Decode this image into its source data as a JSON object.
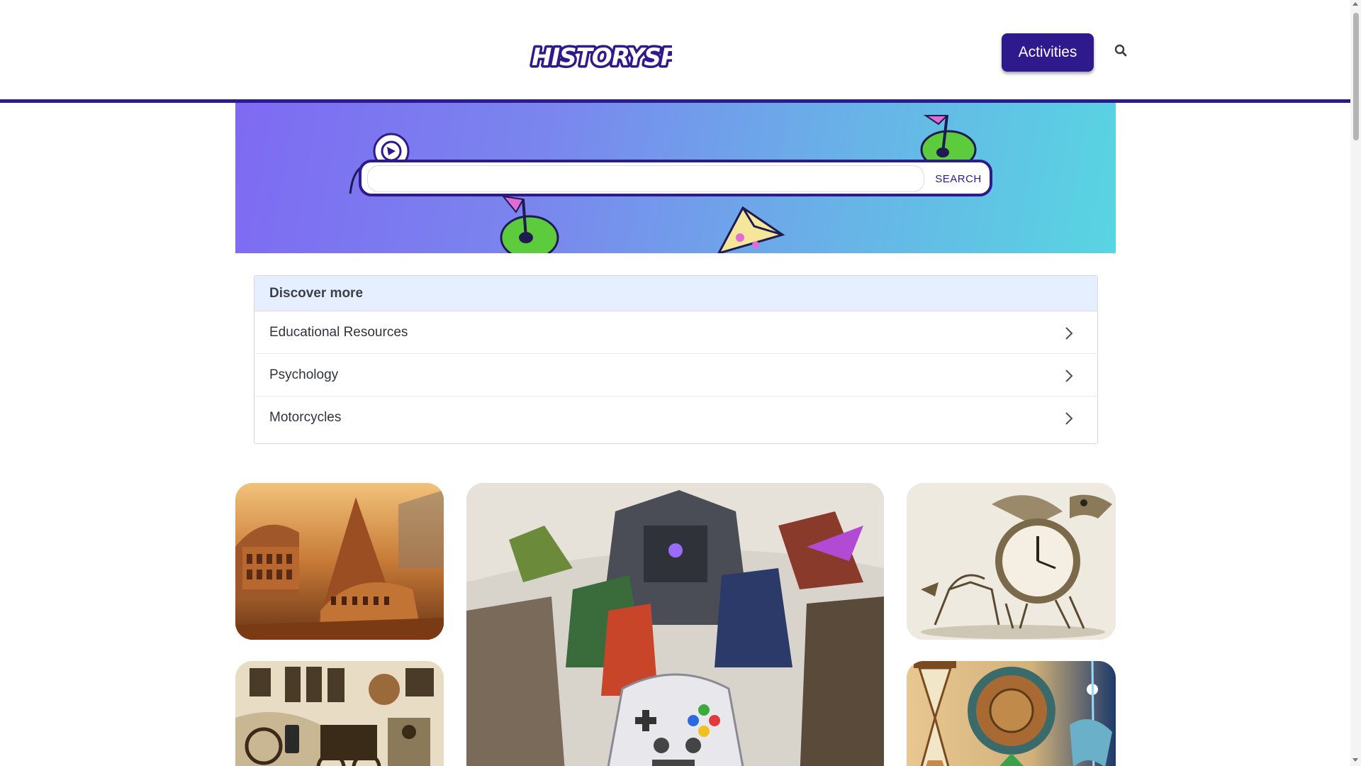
{
  "header": {
    "logo_text": "HISTORYSPOT",
    "activities_label": "Activities",
    "search_icon": "search-icon",
    "accent_color": "#2e1a8c"
  },
  "hero": {
    "search_placeholder": "",
    "search_button_label": "SEARCH",
    "gradient": [
      "#7e6af2",
      "#58d5e2"
    ]
  },
  "discover": {
    "title": "Discover more",
    "items": [
      {
        "label": "Educational Resources",
        "icon": "chevron-right-icon"
      },
      {
        "label": "Psychology",
        "icon": "chevron-right-icon"
      },
      {
        "label": "Motorcycles",
        "icon": "chevron-right-icon"
      }
    ]
  },
  "gallery": {
    "images": [
      {
        "subject": "ancient-architecture-collage"
      },
      {
        "subject": "video-game-characters-collage"
      },
      {
        "subject": "clock-bird-skeleton"
      },
      {
        "subject": "industrial-revolution-collage"
      },
      {
        "subject": "hourglass-ornament"
      }
    ]
  }
}
